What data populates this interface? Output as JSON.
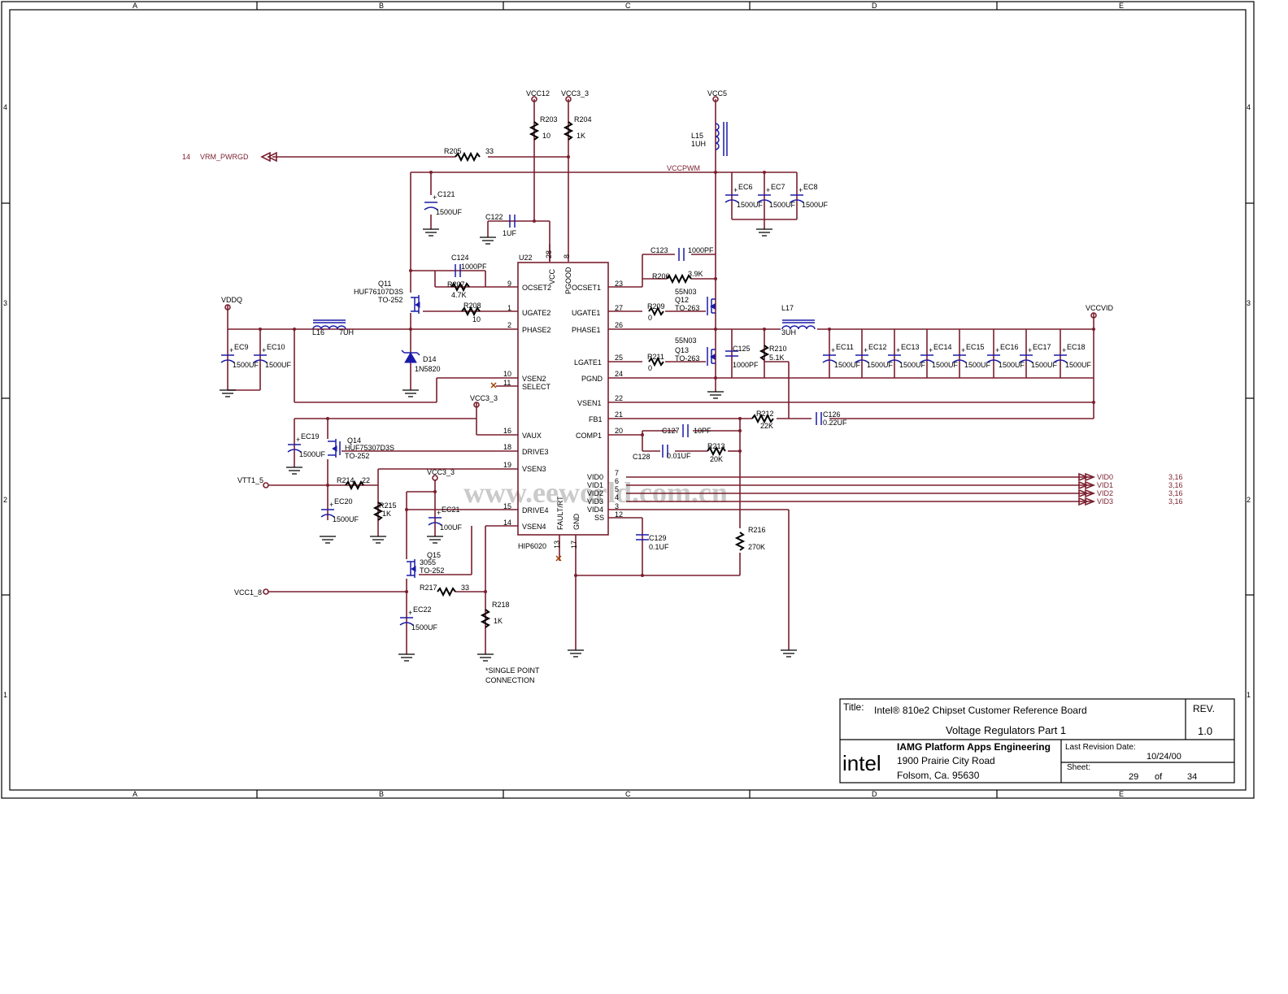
{
  "frame": {
    "col_labels": [
      "A",
      "B",
      "C",
      "D",
      "E"
    ],
    "row_labels": [
      "4",
      "3",
      "2",
      "1"
    ]
  },
  "watermark": "www.eeworld.com.cn",
  "title_block": {
    "title_label": "Title:",
    "title": "Intel® 810e2 Chipset Customer Reference Board",
    "subtitle": "Voltage Regulators Part 1",
    "rev_label": "REV.",
    "rev": "1.0",
    "logo": "intel",
    "company": "IAMG Platform Apps Engineering",
    "address1": "1900 Prairie City Road",
    "address2": "Folsom, Ca. 95630",
    "revision_date_label": "Last Revision Date:",
    "revision_date": "10/24/00",
    "sheet_label": "Sheet:",
    "sheet": "29",
    "of_label": "of",
    "sheet_total": "34"
  },
  "ic": {
    "ref": "U22",
    "part": "HIP6020",
    "left_pins": [
      {
        "num": "9",
        "name": "OCSET2"
      },
      {
        "num": "1",
        "name": "UGATE2"
      },
      {
        "num": "2",
        "name": "PHASE2"
      },
      {
        "num": "10",
        "name": "VSEN2"
      },
      {
        "num": "11",
        "name": "SELECT"
      },
      {
        "num": "16",
        "name": "VAUX"
      },
      {
        "num": "18",
        "name": "DRIVE3"
      },
      {
        "num": "19",
        "name": "VSEN3"
      },
      {
        "num": "15",
        "name": "DRIVE4"
      },
      {
        "num": "14",
        "name": "VSEN4"
      }
    ],
    "right_pins": [
      {
        "num": "23",
        "name": "OCSET1"
      },
      {
        "num": "27",
        "name": "UGATE1"
      },
      {
        "num": "26",
        "name": "PHASE1"
      },
      {
        "num": "25",
        "name": "LGATE1"
      },
      {
        "num": "24",
        "name": "PGND"
      },
      {
        "num": "22",
        "name": "VSEN1"
      },
      {
        "num": "21",
        "name": "FB1"
      },
      {
        "num": "20",
        "name": "COMP1"
      },
      {
        "num": "7",
        "name": "VID0"
      },
      {
        "num": "6",
        "name": "VID1"
      },
      {
        "num": "5",
        "name": "VID2"
      },
      {
        "num": "4",
        "name": "VID3"
      },
      {
        "num": "3",
        "name": "VID4"
      },
      {
        "num": "12",
        "name": "SS"
      }
    ],
    "top_pins": [
      {
        "num": "28",
        "name": "VCC"
      },
      {
        "num": "8",
        "name": "PGOOD"
      }
    ],
    "bottom_pins": [
      {
        "num": "13",
        "name": "FAULT/RT"
      },
      {
        "num": "17",
        "name": "GND"
      }
    ]
  },
  "nets": {
    "vcc12": "VCC12",
    "vcc3_3": "VCC3_3",
    "vcc5": "VCC5",
    "vccpwm": "VCCPWM",
    "vddq": "VDDQ",
    "vccvid": "VCCVID",
    "vtt": "VTT1_5",
    "vcc18": "VCC1_8",
    "vrm_pwrgd": "VRM_PWRGD",
    "vrm_ref": "14",
    "vid_ref": "3,16",
    "vid": [
      "VID0",
      "VID1",
      "VID2",
      "VID3"
    ]
  },
  "components": {
    "R203": {
      "ref": "R203",
      "val": "10"
    },
    "R204": {
      "ref": "R204",
      "val": "1K"
    },
    "R205": {
      "ref": "R205",
      "val": "33"
    },
    "C121": {
      "ref": "C121",
      "val": "1500UF"
    },
    "C122": {
      "ref": "C122",
      "val": "1UF"
    },
    "L15": {
      "ref": "L15",
      "val": "1UH"
    },
    "EC6": {
      "ref": "EC6",
      "val": "1500UF"
    },
    "EC7": {
      "ref": "EC7",
      "val": "1500UF"
    },
    "EC8": {
      "ref": "EC8",
      "val": "1500UF"
    },
    "C123": {
      "ref": "C123",
      "val": "1000PF"
    },
    "R206": {
      "ref": "R206",
      "val": "3.9K"
    },
    "C124": {
      "ref": "C124",
      "val": "1000PF"
    },
    "R207": {
      "ref": "R207",
      "val": "4.7K"
    },
    "R208": {
      "ref": "R208",
      "val": "10"
    },
    "Q11": {
      "ref": "Q11",
      "val": "HUF76107D3S",
      "pkg": "TO-252"
    },
    "Q12": {
      "ref": "Q12",
      "val": "55N03",
      "pkg": "TO-263"
    },
    "Q13": {
      "ref": "Q13",
      "val": "55N03",
      "pkg": "TO-263"
    },
    "R209": {
      "ref": "R209",
      "val": "0"
    },
    "R211": {
      "ref": "R211",
      "val": "0"
    },
    "L16": {
      "ref": "L16",
      "val": "7UH"
    },
    "L17": {
      "ref": "L17",
      "val": "3UH"
    },
    "EC9": {
      "ref": "EC9",
      "val": "1500UF"
    },
    "EC10": {
      "ref": "EC10",
      "val": "1500UF"
    },
    "D14": {
      "ref": "D14",
      "val": "1N5820"
    },
    "C125": {
      "ref": "C125",
      "val": "1000PF"
    },
    "R210": {
      "ref": "R210",
      "val": "5.1K"
    },
    "EC11": {
      "ref": "EC11",
      "val": "1500UF"
    },
    "EC12": {
      "ref": "EC12",
      "val": "1500UF"
    },
    "EC13": {
      "ref": "EC13",
      "val": "1500UF"
    },
    "EC14": {
      "ref": "EC14",
      "val": "1500UF"
    },
    "EC15": {
      "ref": "EC15",
      "val": "1500UF"
    },
    "EC16": {
      "ref": "EC16",
      "val": "1500UF"
    },
    "EC17": {
      "ref": "EC17",
      "val": "1500UF"
    },
    "EC18": {
      "ref": "EC18",
      "val": "1500UF"
    },
    "R212": {
      "ref": "R212",
      "val": "22K"
    },
    "C126": {
      "ref": "C126",
      "val": "0.22UF"
    },
    "C127": {
      "ref": "C127",
      "val": "10PF"
    },
    "C128": {
      "ref": "C128",
      "val": "0.01UF"
    },
    "R213": {
      "ref": "R213",
      "val": "20K"
    },
    "EC19": {
      "ref": "EC19",
      "val": "1500UF"
    },
    "Q14": {
      "ref": "Q14",
      "val": "HUF75307D3S",
      "pkg": "TO-252"
    },
    "R214": {
      "ref": "R214",
      "val": "22"
    },
    "R215": {
      "ref": "R215",
      "val": "1K"
    },
    "EC20": {
      "ref": "EC20",
      "val": "1500UF"
    },
    "EC21": {
      "ref": "EC21",
      "val": "100UF"
    },
    "Q15": {
      "ref": "Q15",
      "val": "3055",
      "pkg": "TO-252"
    },
    "R217": {
      "ref": "R217",
      "val": "33"
    },
    "EC22": {
      "ref": "EC22",
      "val": "1500UF"
    },
    "R218": {
      "ref": "R218",
      "val": "1K"
    },
    "C129": {
      "ref": "C129",
      "val": "0.1UF"
    },
    "R216": {
      "ref": "R216",
      "val": "270K"
    }
  },
  "notes": {
    "single_point_1": "*SINGLE POINT",
    "single_point_2": "CONNECTION"
  }
}
